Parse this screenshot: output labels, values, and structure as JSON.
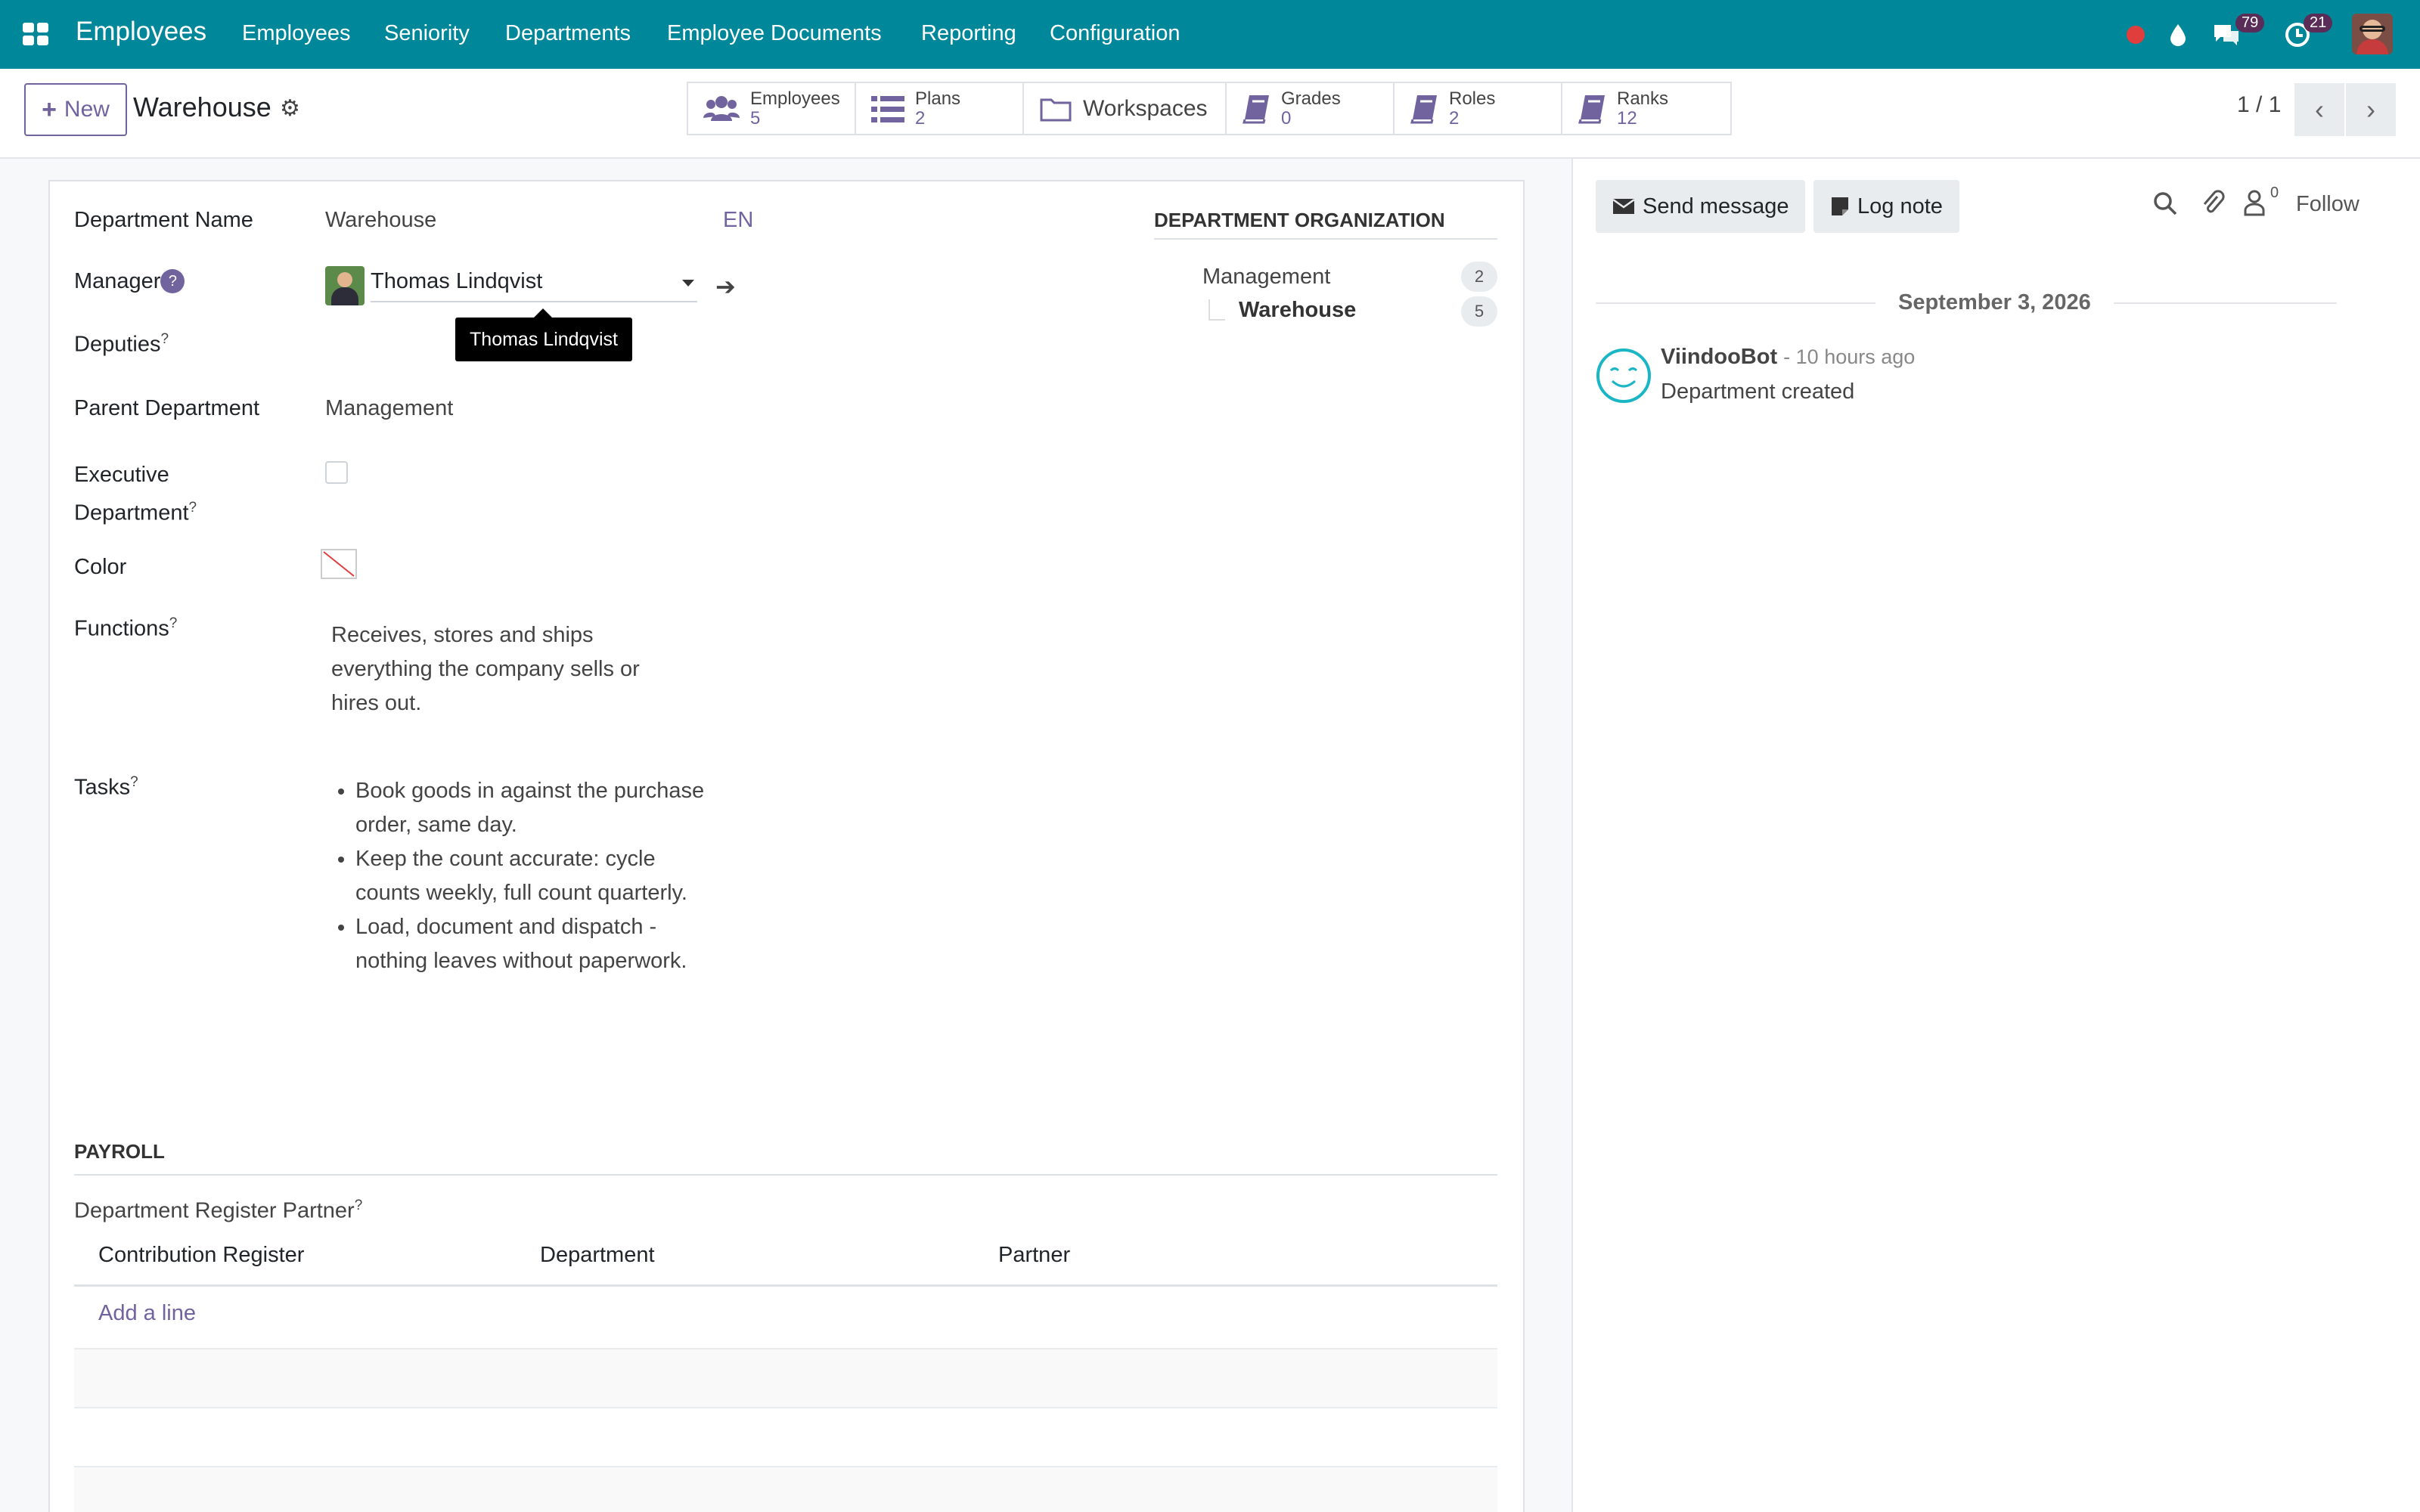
{
  "topbar": {
    "app_title": "Employees",
    "menu": [
      "Employees",
      "Seniority",
      "Departments",
      "Employee Documents",
      "Reporting",
      "Configuration"
    ],
    "messages_count": "79",
    "activities_count": "21",
    "accent_color": "#00879a"
  },
  "control": {
    "new_label": "New",
    "record_title": "Warehouse",
    "pager": "1 / 1",
    "smart_buttons": [
      {
        "label": "Employees",
        "count": "5",
        "icon": "users-icon"
      },
      {
        "label": "Plans",
        "count": "2",
        "icon": "list-icon"
      },
      {
        "label": "Workspaces",
        "icon": "folder-icon"
      },
      {
        "label": "Grades",
        "count": "0",
        "icon": "book-icon"
      },
      {
        "label": "Roles",
        "count": "2",
        "icon": "book-icon"
      },
      {
        "label": "Ranks",
        "count": "12",
        "icon": "book-icon"
      }
    ]
  },
  "form": {
    "department_name_label": "Department Name",
    "department_name_value": "Warehouse",
    "lang": "EN",
    "manager_label": "Manager",
    "manager_value": "Thomas Lindqvist",
    "manager_tooltip": "Thomas Lindqvist",
    "deputies_label": "Deputies",
    "parent_label": "Parent Department",
    "parent_value": "Management",
    "executive_label_1": "Executive",
    "executive_label_2": "Department",
    "executive_checked": false,
    "color_label": "Color",
    "functions_label": "Functions",
    "functions_lines": [
      "Receives, stores and ships",
      "everything the company sells or",
      "hires out."
    ],
    "tasks_label": "Tasks",
    "tasks": [
      "Book goods in against the purchase order, same day.",
      "Keep the count accurate: cycle counts weekly, full count quarterly.",
      "Load, document and dispatch - nothing leaves without paperwork."
    ],
    "help_mark": "?"
  },
  "organization": {
    "title": "DEPARTMENT ORGANIZATION",
    "items": [
      {
        "name": "Management",
        "count": "2"
      },
      {
        "name": "Warehouse",
        "count": "5"
      }
    ]
  },
  "payroll": {
    "title": "PAYROLL",
    "subtitle": "Department Register Partner",
    "columns": [
      "Contribution Register",
      "Department",
      "Partner"
    ],
    "add_line": "Add a line"
  },
  "chatter": {
    "send_message": "Send message",
    "log_note": "Log note",
    "followers_count": "0",
    "follow": "Follow",
    "date": "September 3, 2026",
    "author": "ViindooBot",
    "time": "- 10 hours ago",
    "message": "Department created"
  }
}
